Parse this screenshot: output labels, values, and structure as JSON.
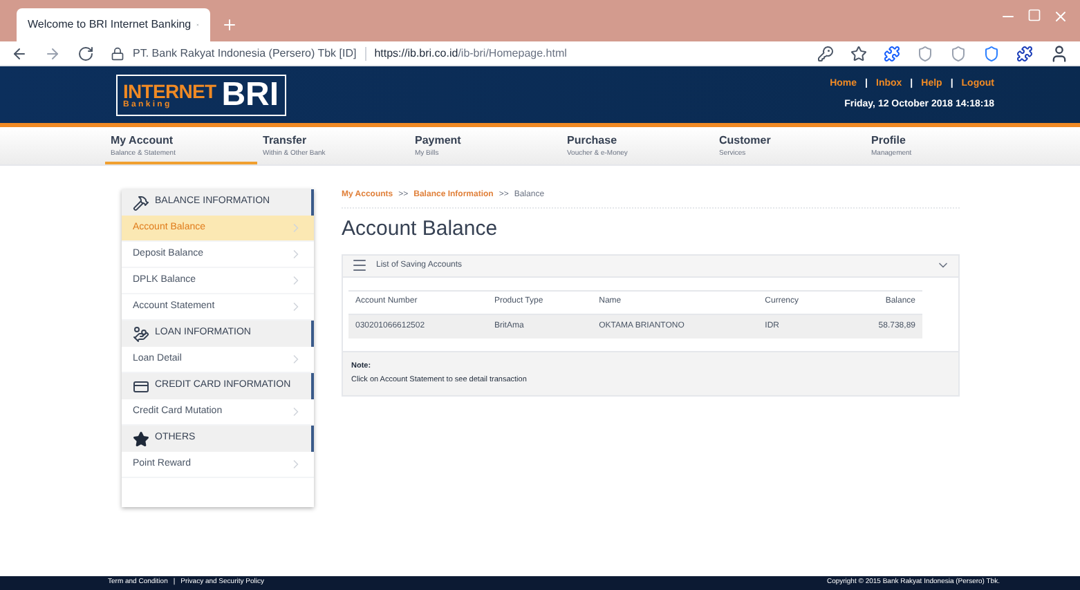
{
  "browser": {
    "tab_title": "Welcome to BRI Internet Banking",
    "site_identity": "PT. Bank Rakyat Indonesia (Persero) Tbk [ID]",
    "url_host": "https://ib.bri.co.id",
    "url_path": "/ib-bri/Homepage.html"
  },
  "header": {
    "logo": {
      "line1": "INTERNET",
      "line2": "B a n k i n g",
      "brand": "BRI"
    },
    "links": [
      "Home",
      "Inbox",
      "Help",
      "Logout"
    ],
    "separator": "|",
    "datetime": "Friday, 12 October 2018 14:18:18"
  },
  "nav": [
    {
      "title": "My Account",
      "subtitle": "Balance & Statement",
      "selected": true
    },
    {
      "title": "Transfer",
      "subtitle": "Within & Other Bank",
      "selected": false
    },
    {
      "title": "Payment",
      "subtitle": "My Bills",
      "selected": false
    },
    {
      "title": "Purchase",
      "subtitle": "Voucher & e-Money",
      "selected": false
    },
    {
      "title": "Customer",
      "subtitle": "Services",
      "selected": false
    },
    {
      "title": "Profile",
      "subtitle": "Management",
      "selected": false
    }
  ],
  "sidebar": [
    {
      "title": "BALANCE INFORMATION",
      "kind": "balance",
      "items": [
        {
          "label": "Account Balance",
          "selected": true
        },
        {
          "label": "Deposit Balance",
          "selected": false
        },
        {
          "label": "DPLK Balance",
          "selected": false
        },
        {
          "label": "Account Statement",
          "selected": false
        }
      ]
    },
    {
      "title": "LOAN INFORMATION",
      "kind": "loan",
      "items": [
        {
          "label": "Loan Detail",
          "selected": false
        }
      ]
    },
    {
      "title": "CREDIT CARD INFORMATION",
      "kind": "card",
      "items": [
        {
          "label": "Credit Card Mutation",
          "selected": false
        }
      ]
    },
    {
      "title": "OTHERS",
      "kind": "star",
      "items": [
        {
          "label": "Point Reward",
          "selected": false
        }
      ]
    }
  ],
  "breadcrumb": {
    "links": [
      "My Accounts",
      "Balance Information"
    ],
    "separator": ">>",
    "current": "Balance"
  },
  "page_title": "Account Balance",
  "panel": {
    "title": "List of Saving Accounts",
    "table": {
      "columns": [
        "Account Number",
        "Product Type",
        "Name",
        "Currency",
        "Balance"
      ],
      "rows": [
        [
          "030201066612502",
          "BritAma",
          "OKTAMA BRIANTONO",
          "IDR",
          "58.738,89"
        ]
      ]
    },
    "note_title": "Note:",
    "note": "Click on Account Statement to see detail transaction"
  },
  "footer": {
    "links": [
      "Term and Condition",
      "Privacy and Security Policy"
    ],
    "separator": "|",
    "copyright": "Copyright © 2015 Bank Rakyat Indonesia (Persero) Tbk."
  }
}
